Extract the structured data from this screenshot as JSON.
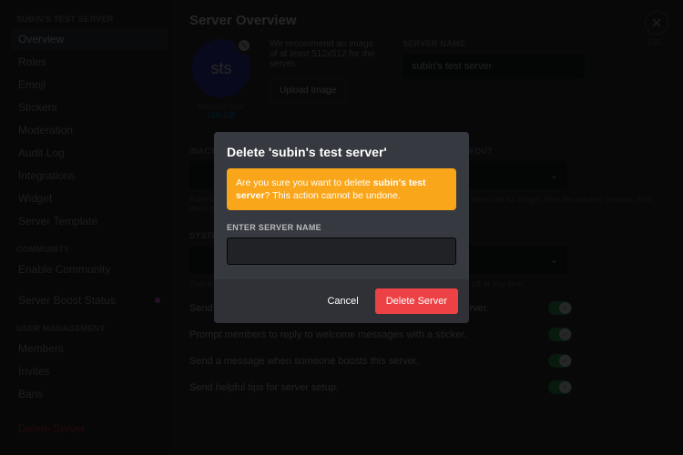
{
  "sidebar": {
    "server_heading": "SUBIN'S TEST SERVER",
    "items": [
      "Overview",
      "Roles",
      "Emoji",
      "Stickers",
      "Moderation",
      "Audit Log",
      "Integrations",
      "Widget",
      "Server Template"
    ],
    "community_heading": "COMMUNITY",
    "community_item": "Enable Community",
    "boost_item": "Server Boost Status",
    "user_mgmt_heading": "USER MANAGEMENT",
    "user_items": [
      "Members",
      "Invites",
      "Bans"
    ],
    "delete_item": "Delete Server"
  },
  "main": {
    "title": "Server Overview",
    "esc": "ESC",
    "avatar_initials": "sts",
    "min_size_prefix": "Minimum Size: ",
    "min_size_link": "128x128",
    "recommend": "We recommend an image of at least 512x512 for the server.",
    "upload": "Upload Image",
    "name_label": "SERVER NAME",
    "name_value": "subin's test server",
    "inactive_channel_label": "INACTIVE CHANNEL",
    "inactive_timeout_label": "INACTIVE TIMEOUT",
    "inactive_help": "Automatically move members to this channel and mute them when they have been idle for longer than the inactive timeout. This does not affect browsers.",
    "system_label": "SYSTEM MESSAGES CHANNEL",
    "system_help": "This is the channel we send system event messages to. These can be turned off at any time.",
    "toggles": [
      "Send a random welcome message when someone joins this server.",
      "Prompt members to reply to welcome messages with a sticker.",
      "Send a message when someone boosts this server.",
      "Send helpful tips for server setup."
    ]
  },
  "modal": {
    "title": "Delete 'subin's test server'",
    "warn_prefix": "Are you sure you want to delete ",
    "warn_bold": "subin's test server",
    "warn_suffix": "? This action cannot be undone.",
    "input_label": "ENTER SERVER NAME",
    "cancel": "Cancel",
    "delete": "Delete Server"
  }
}
